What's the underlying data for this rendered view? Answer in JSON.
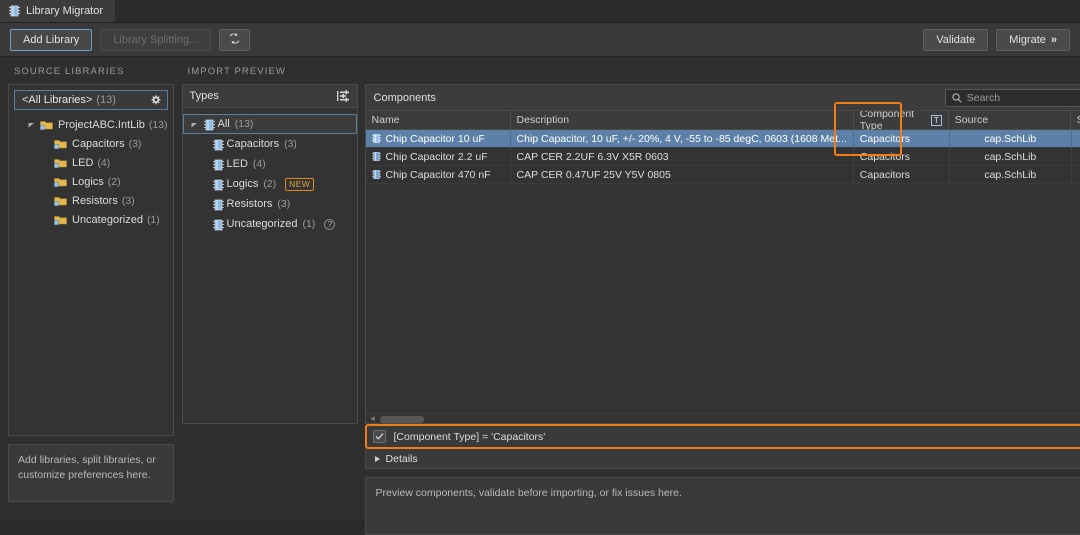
{
  "tab": {
    "label": "Library Migrator",
    "icon": "chip-icon"
  },
  "toolbar": {
    "add_library": "Add Library",
    "library_splitting": "Library Splitting...",
    "sync_icon": "sync-swap-icon",
    "validate": "Validate",
    "migrate": "Migrate",
    "migrate_chevron": "»"
  },
  "source_libraries": {
    "section_label": "SOURCE LIBRARIES",
    "all_libraries": {
      "label": "<All Libraries>",
      "count": "(13)",
      "gear_icon": "gear-icon"
    },
    "tree": [
      {
        "label": "ProjectABC.IntLib",
        "count": "(13)",
        "level": 1,
        "expanded": true
      },
      {
        "label": "Capacitors",
        "count": "(3)",
        "level": 2
      },
      {
        "label": "LED",
        "count": "(4)",
        "level": 2
      },
      {
        "label": "Logics",
        "count": "(2)",
        "level": 2
      },
      {
        "label": "Resistors",
        "count": "(3)",
        "level": 2
      },
      {
        "label": "Uncategorized",
        "count": "(1)",
        "level": 2
      }
    ],
    "hint": "Add libraries, split libraries, or customize preferences here."
  },
  "import_preview": {
    "section_label": "IMPORT PREVIEW",
    "types": {
      "header": "Types",
      "header_icon": "filter-list-icon",
      "tree": [
        {
          "label": "All",
          "count": "(13)",
          "level": 1,
          "selected": true
        },
        {
          "label": "Capacitors",
          "count": "(3)",
          "level": 2
        },
        {
          "label": "LED",
          "count": "(4)",
          "level": 2
        },
        {
          "label": "Logics",
          "count": "(2)",
          "level": 2,
          "badge": "NEW"
        },
        {
          "label": "Resistors",
          "count": "(3)",
          "level": 2
        },
        {
          "label": "Uncategorized",
          "count": "(1)",
          "level": 2,
          "help": true
        }
      ]
    },
    "components": {
      "header": "Components",
      "search_placeholder": "Search",
      "search_value": "",
      "search_icon": "search-icon",
      "columns": [
        "Name",
        "Description",
        "Component Type",
        "Source",
        "St..."
      ],
      "type_filter_icon": "text-filter-icon",
      "rows": [
        {
          "name": "Chip Capacitor 10 uF",
          "description": "Chip Capacitor, 10 uF, +/- 20%, 4 V, -55 to -85 degC, 0603 (1608 Met...",
          "type": "Capacitors",
          "source": "cap.SchLib",
          "status": "",
          "selected": true
        },
        {
          "name": "Chip Capacitor 2.2 uF",
          "description": "CAP CER 2.2UF 6.3V X5R 0603",
          "type": "Capacitors",
          "source": "cap.SchLib",
          "status": "",
          "selected": false
        },
        {
          "name": "Chip Capacitor 470 nF",
          "description": "CAP CER 0.47UF 25V Y5V 0805",
          "type": "Capacitors",
          "source": "cap.SchLib",
          "status": "",
          "selected": false
        }
      ]
    },
    "filter": {
      "expression": "[Component Type] = 'Capacitors'",
      "enabled": true,
      "edit_icon": "pencil-icon",
      "delete_icon": "close-icon"
    },
    "details_label": "Details",
    "hint": "Preview components, validate before importing, or fix issues here."
  },
  "colors": {
    "accent_orange": "#f07d18",
    "selection_blue": "#5d80a8",
    "focus_border": "#5c7fa0",
    "badge_new": "#e0a33c"
  }
}
